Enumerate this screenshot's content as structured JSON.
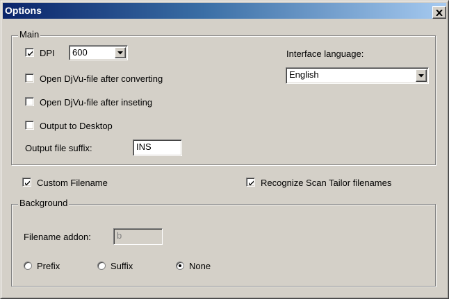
{
  "window": {
    "title": "Options"
  },
  "main_group": {
    "legend": "Main",
    "dpi": {
      "label": "DPI",
      "checked": true,
      "value": "600"
    },
    "open_after_converting": {
      "label": "Open DjVu-file after converting",
      "checked": false
    },
    "open_after_inseting": {
      "label": "Open DjVu-file after inseting",
      "checked": false
    },
    "output_to_desktop": {
      "label": "Output to Desktop",
      "checked": false
    },
    "output_suffix": {
      "label": "Output file suffix:",
      "value": "INS"
    },
    "interface_language": {
      "label": "Interface language:",
      "value": "English"
    }
  },
  "custom_filename": {
    "label": "Custom Filename",
    "checked": true
  },
  "recognize_scan_tailor": {
    "label": "Recognize Scan Tailor filenames",
    "checked": true
  },
  "background_group": {
    "legend": "Background",
    "filename_addon": {
      "label": "Filename addon:",
      "value": "b"
    },
    "position": {
      "options": [
        "Prefix",
        "Suffix",
        "None"
      ],
      "selected": "None"
    }
  },
  "icons": {
    "close": "close-icon",
    "check": "check-icon",
    "dropdown": "chevron-down-icon"
  }
}
